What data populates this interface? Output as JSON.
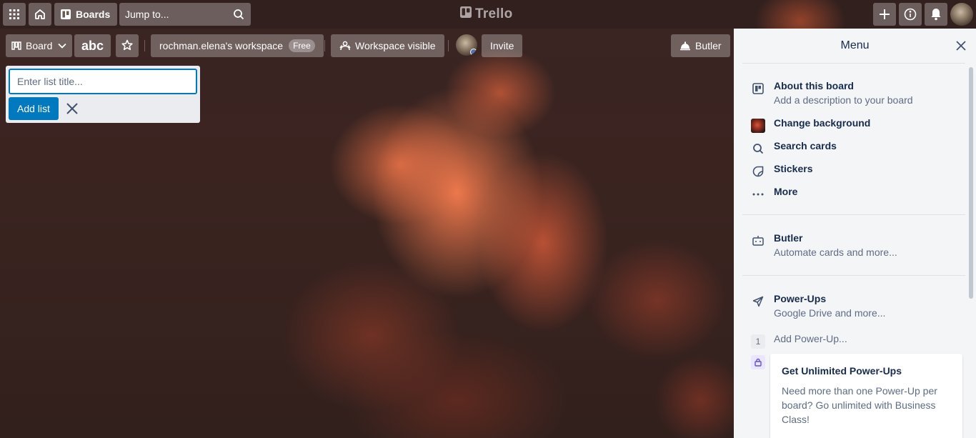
{
  "header": {
    "apps_icon": "grid-icon",
    "home_icon": "home-icon",
    "boards_label": "Boards",
    "jump_placeholder": "Jump to...",
    "logo_text": "Trello",
    "create_icon": "plus-icon",
    "info_icon": "info-icon",
    "notifications_icon": "bell-icon"
  },
  "board_header": {
    "view_label": "Board",
    "board_title": "abc",
    "workspace_name": "rochman.elena's workspace",
    "plan_badge": "Free",
    "visibility_label": "Workspace visible",
    "invite_label": "Invite",
    "butler_label": "Butler"
  },
  "composer": {
    "placeholder": "Enter list title...",
    "add_label": "Add list"
  },
  "menu": {
    "title": "Menu",
    "items": [
      {
        "icon": "board-icon",
        "label": "About this board",
        "sub": "Add a description to your board"
      },
      {
        "icon": "background-thumbnail",
        "label": "Change background"
      },
      {
        "icon": "search-icon",
        "label": "Search cards"
      },
      {
        "icon": "sticker-icon",
        "label": "Stickers"
      },
      {
        "icon": "ellipsis-icon",
        "label": "More"
      }
    ],
    "butler": {
      "label": "Butler",
      "sub": "Automate cards and more..."
    },
    "powerups": {
      "label": "Power-Ups",
      "sub": "Google Drive and more..."
    },
    "add_powerup": {
      "count": "1",
      "label": "Add Power-Up..."
    },
    "promo": {
      "title": "Get Unlimited Power-Ups",
      "text": "Need more than one Power-Up per board? Go unlimited with Business Class!"
    }
  },
  "colors": {
    "accent": "#0079bf",
    "menu_bg": "#f4f5f7",
    "text": "#172b4d",
    "subtext": "#5e6c84"
  }
}
